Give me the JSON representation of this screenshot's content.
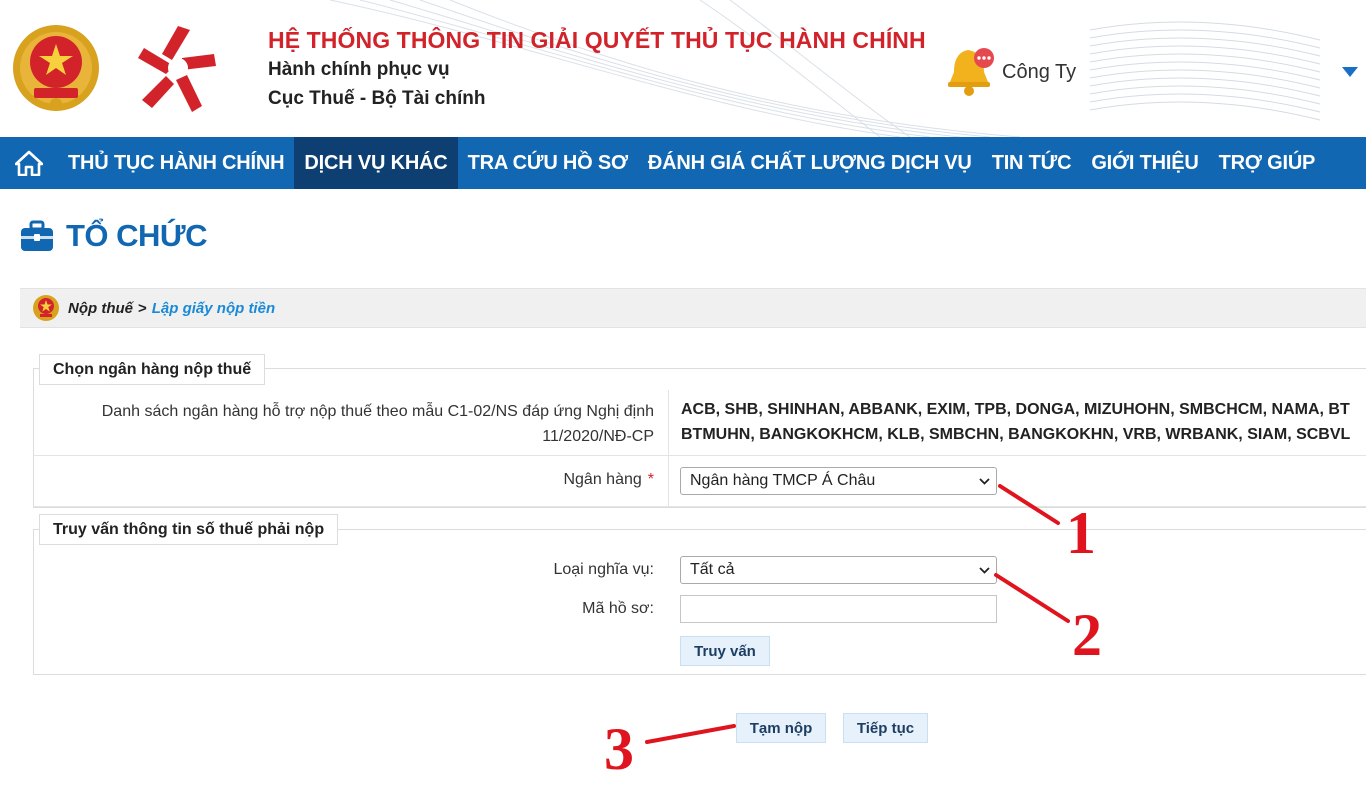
{
  "header": {
    "system_title": "HỆ THỐNG THÔNG TIN GIẢI QUYẾT THỦ TỤC HÀNH CHÍNH",
    "subtitle_1": "Hành chính phục vụ",
    "subtitle_2": "Cục Thuế - Bộ Tài chính",
    "user_name": "Công Ty",
    "colors": {
      "title_red": "#d2232a",
      "nav_blue": "#1167b1",
      "nav_active": "#0d3f72"
    }
  },
  "nav": {
    "items": [
      {
        "label": "THỦ TỤC HÀNH CHÍNH"
      },
      {
        "label": "DỊCH VỤ KHÁC",
        "active": true
      },
      {
        "label": "TRA CỨU HỒ SƠ"
      },
      {
        "label": "ĐÁNH GIÁ CHẤT LƯỢNG DỊCH VỤ"
      },
      {
        "label": "TIN TỨC"
      },
      {
        "label": "GIỚI THIỆU"
      },
      {
        "label": "TRỢ GIÚP"
      }
    ]
  },
  "page": {
    "heading": "TỔ CHỨC",
    "breadcrumb": {
      "part1": "Nộp thuế",
      "separator": ">",
      "part2": "Lập giấy nộp tiền"
    }
  },
  "section_bank": {
    "legend": "Chọn ngân hàng nộp thuế",
    "list_label_line1": "Danh sách ngân hàng hỗ trợ nộp thuế theo mẫu C1-02/NS đáp ứng Nghị định",
    "list_label_line2": "11/2020/NĐ-CP",
    "list_line1": "ACB, SHB, SHINHAN, ABBANK, EXIM, TPB, DONGA, MIZUHOHN, SMBCHCM, NAMA, BT",
    "list_line2": "BTMUHN, BANGKOKHCM, KLB, SMBCHN, BANGKOKHN, VRB, WRBANK, SIAM, SCBVL",
    "bank_label": "Ngân hàng",
    "required_mark": "*",
    "bank_selected": "Ngân hàng TMCP Á Châu"
  },
  "section_query": {
    "legend": "Truy vấn thông tin số thuế phải nộp",
    "obligation_label": "Loại nghĩa vụ:",
    "obligation_selected": "Tất cả",
    "dossier_label": "Mã hồ sơ:",
    "dossier_value": "",
    "query_button": "Truy vấn"
  },
  "actions": {
    "temp_pay_button": "Tạm nộp",
    "continue_button": "Tiếp tục"
  },
  "annotations": {
    "marker_1": "1",
    "marker_2": "2",
    "marker_3": "3",
    "color": "#e0141e"
  }
}
